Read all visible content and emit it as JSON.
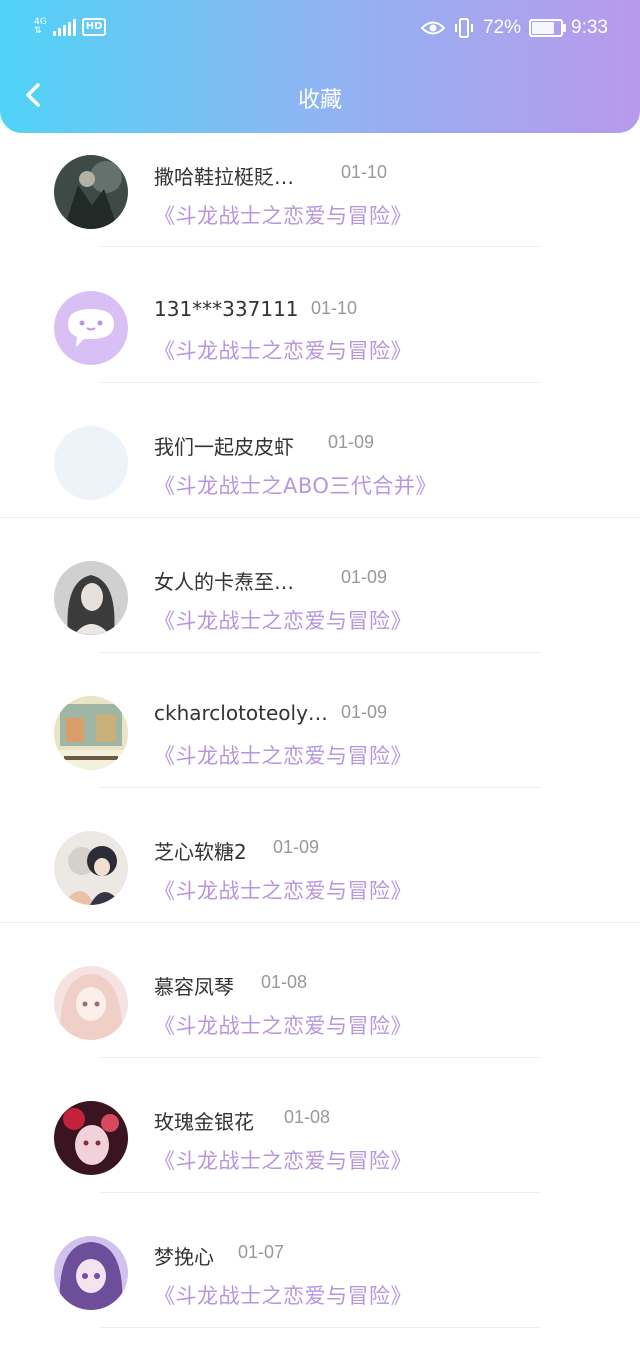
{
  "status_bar": {
    "network": "4G",
    "hd_label": "HD",
    "battery": "72%",
    "battery_level": 0.72,
    "time": "9:33"
  },
  "header": {
    "title": "收藏"
  },
  "favorites": [
    {
      "user": "撒哈鞋拉梃貶…",
      "date": "01-10",
      "book": "《斗龙战士之恋爱与冒险》"
    },
    {
      "user": "131***337111",
      "date": "01-10",
      "book": "《斗龙战士之恋爱与冒险》"
    },
    {
      "user": "我们一起皮皮虾",
      "date": "01-09",
      "book": "《斗龙战士之ABO三代合并》"
    },
    {
      "user": "女人的卡焘至…",
      "date": "01-09",
      "book": "《斗龙战士之恋爱与冒险》"
    },
    {
      "user": "ckharclototeoly…",
      "date": "01-09",
      "book": "《斗龙战士之恋爱与冒险》"
    },
    {
      "user": "芝心软糖2",
      "date": "01-09",
      "book": "《斗龙战士之恋爱与冒险》"
    },
    {
      "user": "慕容凤琴",
      "date": "01-08",
      "book": "《斗龙战士之恋爱与冒险》"
    },
    {
      "user": "玫瑰金银花",
      "date": "01-08",
      "book": "《斗龙战士之恋爱与冒险》"
    },
    {
      "user": "梦挽心",
      "date": "01-07",
      "book": "《斗龙战士之恋爱与冒险》"
    }
  ],
  "colors": {
    "header_start": "#4fd3f6",
    "header_end": "#b89aea",
    "book_title": "#b896de",
    "date": "#999999"
  }
}
